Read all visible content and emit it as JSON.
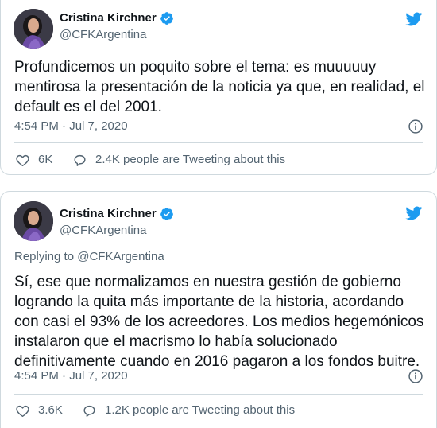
{
  "tweets": [
    {
      "author": {
        "display_name": "Cristina Kirchner",
        "handle": "@CFKArgentina",
        "verified": true
      },
      "replying_to": null,
      "text": "Profundicemos un poquito sobre el tema: es muuuuuy mentirosa la presentación de la noticia ya que, en realidad, el default es el del 2001.",
      "timestamp": "4:54 PM · Jul 7, 2020",
      "likes": "6K",
      "conversation": "2.4K people are Tweeting about this"
    },
    {
      "author": {
        "display_name": "Cristina Kirchner",
        "handle": "@CFKArgentina",
        "verified": true
      },
      "replying_to": {
        "prefix": "Replying to ",
        "handle": "@CFKArgentina"
      },
      "text": "Sí, ese que normalizamos en nuestra gestión de gobierno logrando la quita más importante de la historia, acordando con casi el 93% de los acreedores. Los medios hegemónicos instalaron que el macrismo lo había solucionado definitivamente cuando en 2016 pagaron a los fondos buitre.",
      "timestamp": "4:54 PM · Jul 7, 2020",
      "likes": "3.6K",
      "conversation": "1.2K people are Tweeting about this"
    }
  ],
  "icons": {
    "bird": "twitter-bird-icon",
    "verified": "verified-badge-icon",
    "info": "info-icon",
    "like": "heart-icon",
    "conversation": "speech-bubble-icon"
  },
  "colors": {
    "brand": "#1d9bf0",
    "text": "#0f1419",
    "secondary": "#536471",
    "border": "#cfd9de"
  }
}
